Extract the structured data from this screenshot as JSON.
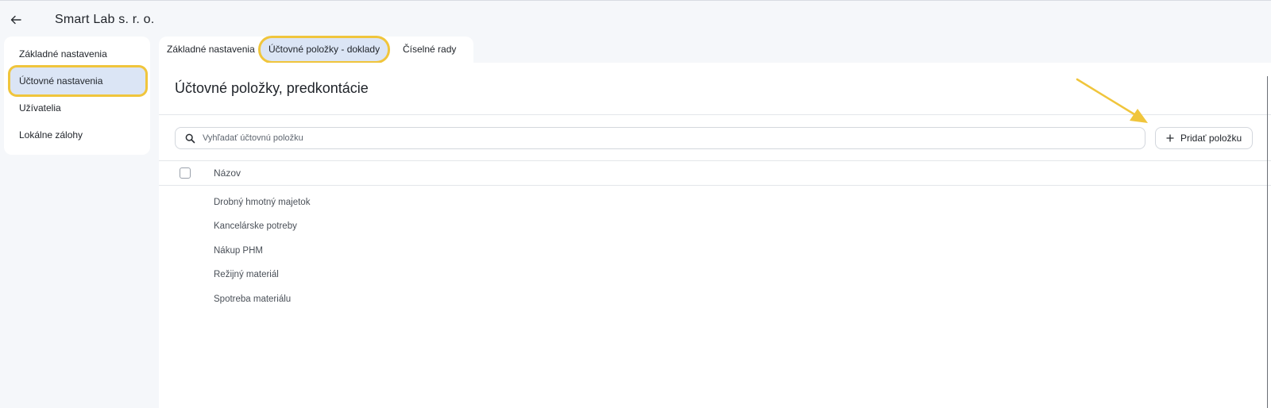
{
  "header": {
    "title": "Smart Lab s. r. o.",
    "back_icon": "arrow-left-icon"
  },
  "sidebar": {
    "items": [
      {
        "label": "Základné nastavenia",
        "active": false
      },
      {
        "label": "Účtovné nastavenia",
        "active": true
      },
      {
        "label": "Užívatelia",
        "active": false
      },
      {
        "label": "Lokálne zálohy",
        "active": false
      }
    ]
  },
  "tabs": [
    {
      "label": "Základné nastavenia",
      "active": false
    },
    {
      "label": "Účtovné položky - doklady",
      "active": true
    },
    {
      "label": "Číselné rady",
      "active": false
    }
  ],
  "main": {
    "title": "Účtovné položky, predkontácie",
    "search": {
      "placeholder": "Vyhľadať účtovnú položku",
      "value": "",
      "icon": "search-icon"
    },
    "add_button": {
      "label": "Pridať položku",
      "icon": "plus-icon"
    },
    "table": {
      "header": "Názov",
      "rows": [
        "Drobný hmotný majetok",
        "Kancelárske potreby",
        "Nákup PHM",
        "Režijný materiál",
        "Spotreba materiálu"
      ]
    }
  },
  "colors": {
    "highlight": "#f0c53c",
    "active_bg": "#dbe5f5",
    "page_bg": "#f5f7fa"
  }
}
